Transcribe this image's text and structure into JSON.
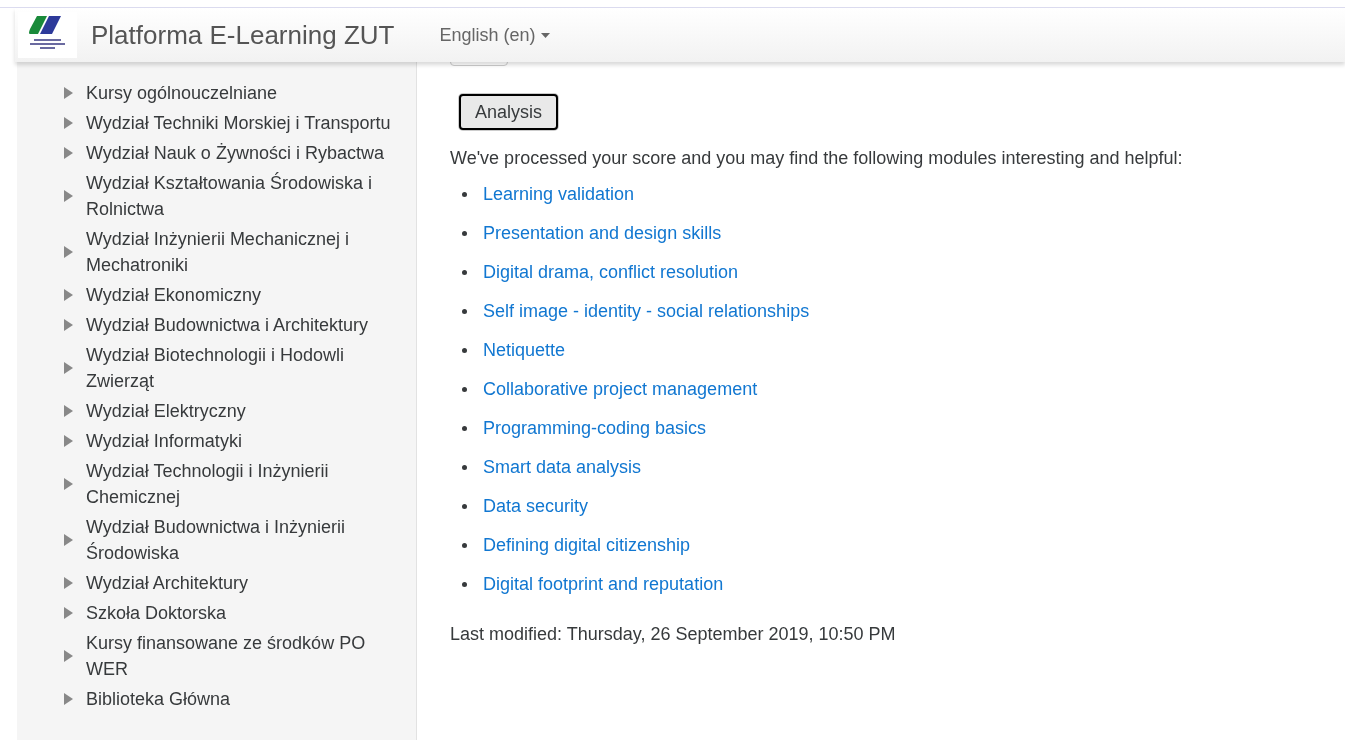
{
  "header": {
    "site_name": "Platforma E-Learning ZUT",
    "language": "English (en)"
  },
  "sidebar": {
    "items": [
      {
        "label": "Kursy ogólnouczelniane",
        "expanded": false
      },
      {
        "label": "Wydział Techniki Morskiej i Transportu",
        "expanded": false
      },
      {
        "label": "Wydział Nauk o Żywności i Rybactwa",
        "expanded": false
      },
      {
        "label": "Wydział Kształtowania Środowiska i Rolnictwa",
        "expanded": false
      },
      {
        "label": "Wydział Inżynierii Mechanicznej i Mechatroniki",
        "expanded": false
      },
      {
        "label": "Wydział Ekonomiczny",
        "expanded": false
      },
      {
        "label": "Wydział Budownictwa i Architektury",
        "expanded": false
      },
      {
        "label": "Wydział Biotechnologii i Hodowli Zwierząt",
        "expanded": false
      },
      {
        "label": "Wydział Elektryczny",
        "expanded": false
      },
      {
        "label": "Wydział Informatyki",
        "expanded": false
      },
      {
        "label": "Wydział Technologii i Inżynierii Chemicznej",
        "expanded": false
      },
      {
        "label": "Wydział Budownictwa i Inżynierii Środowiska",
        "expanded": false
      },
      {
        "label": "Wydział Architektury",
        "expanded": false
      },
      {
        "label": "Szkoła Doktorska",
        "expanded": false
      },
      {
        "label": "Kursy finansowane ze środków PO WER",
        "expanded": false
      },
      {
        "label": "Biblioteka Główna",
        "expanded": false
      }
    ]
  },
  "main": {
    "button": "Analysis",
    "intro": "We've processed your score and you may find the following modules interesting and helpful:",
    "modules": [
      "Learning validation",
      "Presentation and design skills",
      "Digital drama, conflict resolution",
      "Self image - identity - social relationships",
      "Netiquette",
      "Collaborative project management",
      "Programming-coding basics",
      "Smart data analysis",
      "Data security",
      "Defining digital citizenship",
      "Digital footprint and reputation"
    ],
    "last_modified": "Last modified: Thursday, 26 September 2019, 10:50 PM"
  }
}
